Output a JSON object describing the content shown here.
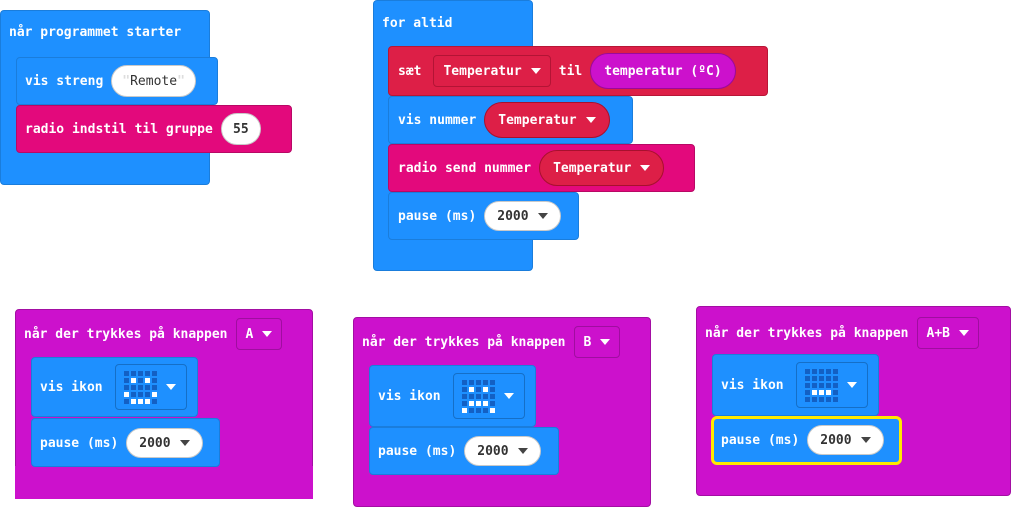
{
  "on_start": {
    "title": "når programmet starter",
    "show_string_label": "vis streng",
    "show_string_open_quote": "\"",
    "show_string_value": "Remote",
    "show_string_close_quote": "\"",
    "radio_group_label": "radio indstil til gruppe",
    "radio_group_value": "55"
  },
  "forever": {
    "title": "for altid",
    "set_label": "sæt",
    "set_variable": "Temperatur",
    "set_to_label": "til",
    "set_value": "temperatur (ºC)",
    "show_number_label": "vis nummer",
    "show_number_value": "Temperatur",
    "radio_send_label": "radio send nummer",
    "radio_send_value": "Temperatur",
    "pause_label": "pause (ms)",
    "pause_value": "2000"
  },
  "button_a": {
    "title": "når der trykkes på knappen",
    "button": "A",
    "show_icon_label": "vis ikon",
    "pause_label": "pause (ms)",
    "pause_value": "2000"
  },
  "button_b": {
    "title": "når der trykkes på knappen",
    "button": "B",
    "show_icon_label": "vis ikon",
    "pause_label": "pause (ms)",
    "pause_value": "2000"
  },
  "button_ab": {
    "title": "når der trykkes på knappen",
    "button": "A+B",
    "show_icon_label": "vis ikon",
    "pause_label": "pause (ms)",
    "pause_value": "2000"
  },
  "colors": {
    "basic_blue": "#1e90ff",
    "input_magenta": "#cc11cc",
    "radio_pink": "#e3097c",
    "variable_red": "#dd1f47",
    "selected_outline": "#ffea00"
  }
}
